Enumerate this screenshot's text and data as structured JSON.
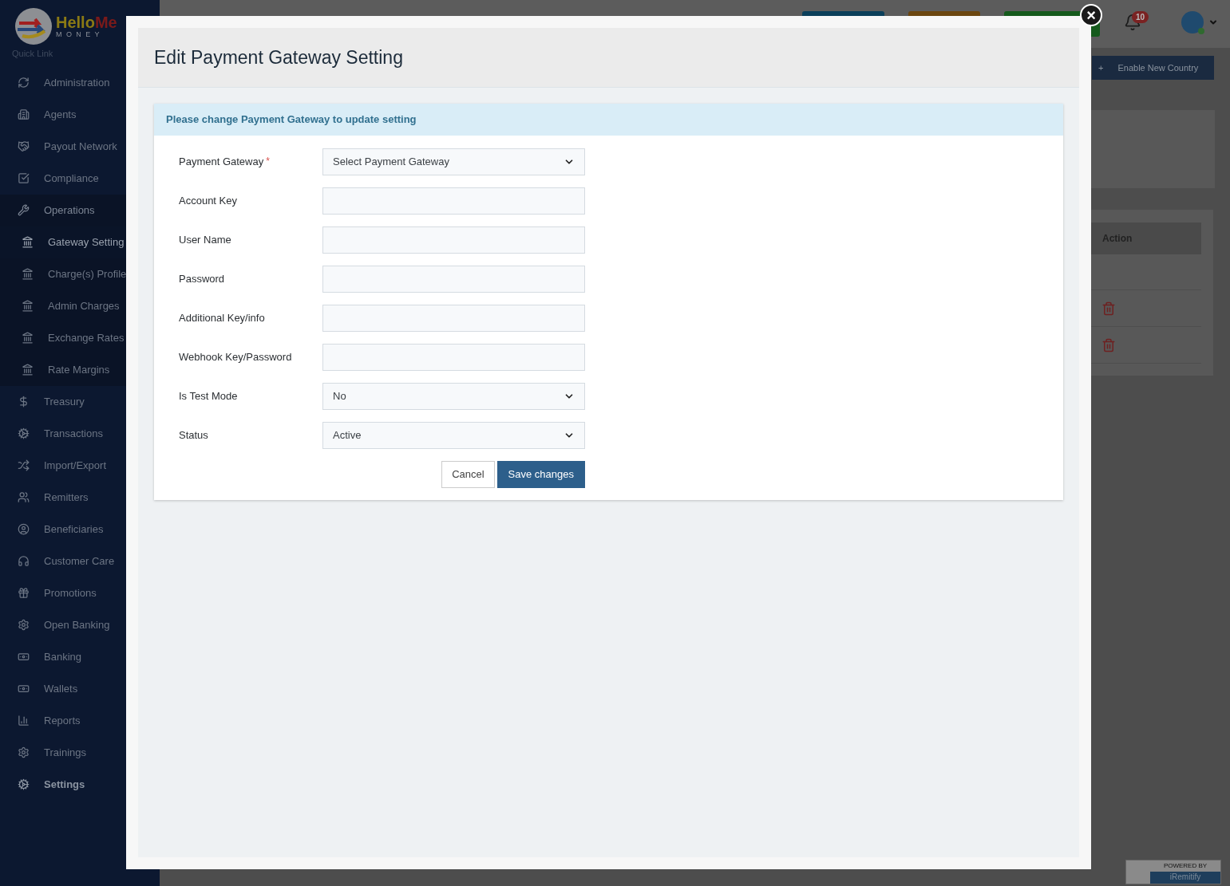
{
  "sidebar": {
    "brand": {
      "name_first": "Hello",
      "name_second": "Me",
      "subtitle": "MONEY"
    },
    "section_title": "Quick Link",
    "items": [
      {
        "label": "Administration",
        "selected": false
      },
      {
        "label": "Agents",
        "selected": false
      },
      {
        "label": "Payout Network",
        "selected": false
      },
      {
        "label": "Compliance",
        "selected": false
      },
      {
        "label": "Operations",
        "selected": false,
        "expanded": true,
        "children": [
          {
            "label": "Gateway Setting",
            "selected": true
          },
          {
            "label": "Charge(s) Profile",
            "selected": false
          },
          {
            "label": "Admin Charges",
            "selected": false
          },
          {
            "label": "Exchange Rates",
            "selected": false
          },
          {
            "label": "Rate Margins",
            "selected": false
          }
        ]
      },
      {
        "label": "Treasury",
        "selected": false
      },
      {
        "label": "Transactions",
        "selected": false
      },
      {
        "label": "Import/Export",
        "selected": false
      },
      {
        "label": "Remitters",
        "selected": false
      },
      {
        "label": "Beneficiaries",
        "selected": false
      },
      {
        "label": "Customer Care",
        "selected": false
      },
      {
        "label": "Promotions",
        "selected": false
      },
      {
        "label": "Open Banking",
        "selected": false
      },
      {
        "label": "Banking",
        "selected": false
      },
      {
        "label": "Wallets",
        "selected": false
      },
      {
        "label": "Reports",
        "selected": false
      },
      {
        "label": "Trainings",
        "selected": false
      },
      {
        "label": "Settings",
        "selected": false,
        "emphasis": true
      }
    ]
  },
  "header": {
    "notification_count": "10"
  },
  "background": {
    "button": {
      "symbol": "+",
      "label": "Enable New Country"
    },
    "table": {
      "columns": [
        "Action"
      ]
    }
  },
  "powered_by": {
    "caption": "POWERED BY",
    "name": "iRemitify"
  },
  "modal": {
    "close_symbol": "×",
    "title": "Edit Payment Gateway Setting",
    "alert": "Please change Payment Gateway to update setting",
    "fields": [
      {
        "label": "Payment Gateway",
        "required_mark": "*",
        "kind": "select",
        "value": "Select Payment Gateway"
      },
      {
        "label": "Account Key",
        "kind": "text"
      },
      {
        "label": "User Name",
        "kind": "text"
      },
      {
        "label": "Password",
        "kind": "text"
      },
      {
        "label": "Additional Key/info",
        "kind": "text"
      },
      {
        "label": "Webhook Key/Password",
        "kind": "text"
      },
      {
        "label": "Is Test Mode",
        "kind": "select",
        "value": "No"
      },
      {
        "label": "Status",
        "kind": "select",
        "value": "Active"
      }
    ],
    "buttons": [
      {
        "label": "Cancel",
        "kind": "secondary"
      },
      {
        "label": "Save changes",
        "kind": "primary"
      }
    ]
  }
}
